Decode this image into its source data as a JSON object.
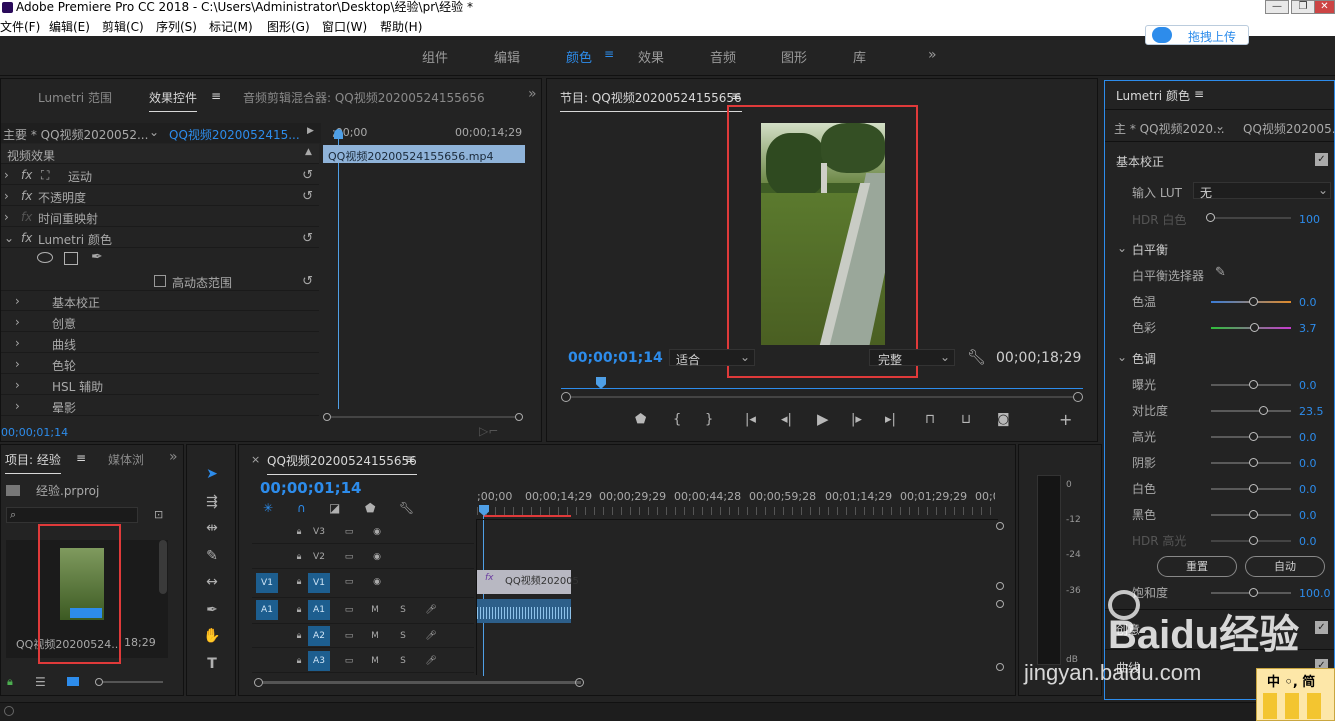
{
  "window": {
    "title": "Adobe Premiere Pro CC 2018 - C:\\Users\\Administrator\\Desktop\\经验\\pr\\经验 *"
  },
  "menu": [
    "文件(F)",
    "编辑(E)",
    "剪辑(C)",
    "序列(S)",
    "标记(M)",
    "图形(G)",
    "窗口(W)",
    "帮助(H)"
  ],
  "workspaces": [
    {
      "label": "组件"
    },
    {
      "label": "编辑"
    },
    {
      "label": "颜色",
      "active": true
    },
    {
      "label": "效果"
    },
    {
      "label": "音频"
    },
    {
      "label": "图形"
    },
    {
      "label": "库"
    }
  ],
  "upload_button": "拖拽上传",
  "effect_panel": {
    "tabs": [
      "Lumetri 范围",
      "效果控件",
      "音频剪辑混合器: QQ视频20200524155656"
    ],
    "master": "主要 * QQ视频2020052...",
    "clip": "QQ视频2020052415...",
    "tc_start": ";00;00",
    "tc_end": "00;00;14;29",
    "clip_bar": "QQ视频20200524155656.mp4",
    "section": "视频效果",
    "effects": [
      "运动",
      "不透明度",
      "时间重映射",
      "Lumetri 颜色"
    ],
    "hdr": "高动态范围",
    "sub": [
      "基本校正",
      "创意",
      "曲线",
      "色轮",
      "HSL 辅助",
      "晕影"
    ],
    "timecode": "00;00;01;14"
  },
  "program": {
    "title": "节目: QQ视频20200524155656",
    "timecode": "00;00;01;14",
    "fit": "适合",
    "quality": "完整",
    "duration": "00;00;18;29"
  },
  "project": {
    "tab1": "项目: 经验",
    "tab2": "媒体浏",
    "file": "经验.prproj",
    "clip_name": "QQ视频20200524...",
    "clip_dur": "18;29"
  },
  "timeline": {
    "title": "QQ视频20200524155656",
    "timecode": "00;00;01;14",
    "ruler": [
      ";00;00",
      "00;00;14;29",
      "00;00;29;29",
      "00;00;44;28",
      "00;00;59;28",
      "00;01;14;29",
      "00;01;29;29",
      "00;0"
    ],
    "tracks": [
      {
        "id": "V3"
      },
      {
        "id": "V2"
      },
      {
        "id": "V1",
        "src": "V1"
      },
      {
        "id": "A1",
        "src": "A1"
      },
      {
        "id": "A2"
      },
      {
        "id": "A3"
      }
    ],
    "clip_label": "QQ视频202005"
  },
  "meter": [
    "0",
    "-12",
    "-24",
    "-36",
    "dB"
  ],
  "lumetri": {
    "title": "Lumetri 颜色",
    "master": "主 * QQ视频2020...",
    "clip": "QQ视频202005...",
    "basic": "基本校正",
    "input_lut": "输入 LUT",
    "lut_value": "无",
    "hdr_white": "HDR 白色",
    "hdr_white_val": "100",
    "wb": "白平衡",
    "wb_picker": "白平衡选择器",
    "temp": "色温",
    "temp_val": "0.0",
    "tint": "色彩",
    "tint_val": "3.7",
    "tone": "色调",
    "tone_rows": [
      {
        "label": "曝光",
        "value": "0.0"
      },
      {
        "label": "对比度",
        "value": "23.5"
      },
      {
        "label": "高光",
        "value": "0.0"
      },
      {
        "label": "阴影",
        "value": "0.0"
      },
      {
        "label": "白色",
        "value": "0.0"
      },
      {
        "label": "黑色",
        "value": "0.0"
      },
      {
        "label": "HDR 高光",
        "value": "0.0"
      }
    ],
    "reset": "重置",
    "auto": "自动",
    "saturation": "饱和度",
    "saturation_val": "100.0",
    "creative": "创意",
    "curves": "曲线"
  },
  "watermark": {
    "text": "Baidu经验",
    "url": "jingyan.baidu.com"
  },
  "ime": "中 ◦, 简"
}
